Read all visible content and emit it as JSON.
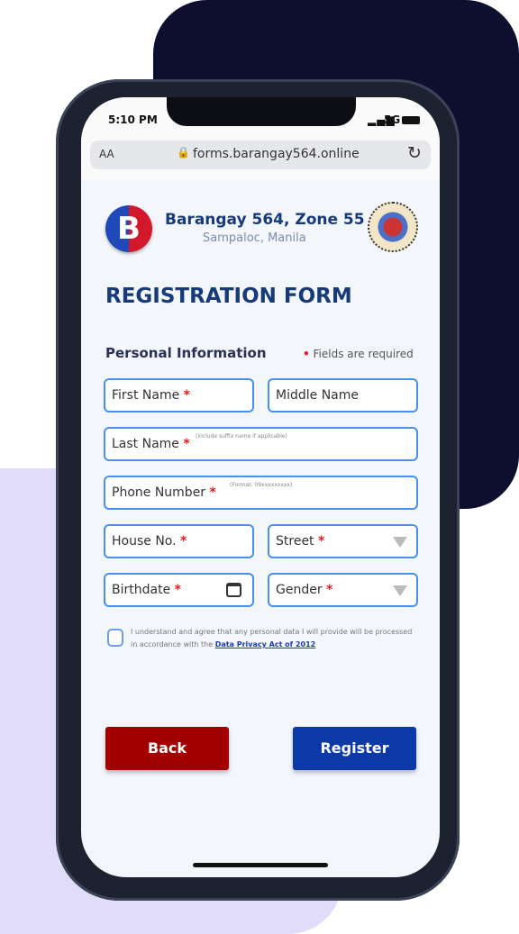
{
  "status": {
    "time": "5:10 PM",
    "network": "5G"
  },
  "browser": {
    "text_size": "AA",
    "url": "forms.barangay564.online"
  },
  "header": {
    "title": "Barangay 564, Zone 55",
    "subtitle": "Sampaloc, Manila",
    "logo": "B"
  },
  "form": {
    "title": "REGISTRATION FORM",
    "section": "Personal Information",
    "required_note": "Fields are required",
    "first_name": "First Name",
    "middle_name": "Middle Name",
    "last_name": "Last Name",
    "last_name_hint": "(include suffix name if applicable)",
    "phone": "Phone Number",
    "phone_hint": "(Format: 09xxxxxxxxx)",
    "house": "House No.",
    "street": "Street",
    "birthdate": "Birthdate",
    "gender": "Gender",
    "consent": "I understand and agree that any personal data I will provide will be processed in accordance with the",
    "consent_link": "Data Privacy Act of 2012",
    "back": "Back",
    "register": "Register"
  },
  "colors": {
    "primary": "#0b3aa8",
    "back": "#a30000",
    "heading": "#173a7a"
  }
}
